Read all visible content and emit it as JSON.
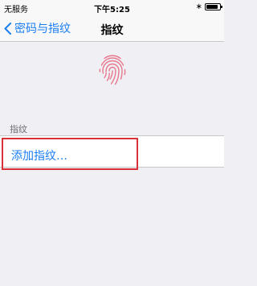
{
  "status_bar": {
    "carrier": "无服务",
    "time": "下午5:25",
    "bluetooth_icon": "bluetooth-icon",
    "battery_icon": "battery-icon",
    "battery_level": 0.85
  },
  "nav": {
    "back_label": "密码与指纹",
    "back_icon": "chevron-left-icon",
    "title": "指纹"
  },
  "fingerprint": {
    "icon": "fingerprint-icon",
    "color": "#e8788e"
  },
  "section": {
    "header": "指纹",
    "add_label": "添加指纹…",
    "highlight_color": "#d9303a"
  },
  "colors": {
    "accent": "#1a7ef2",
    "background": "#efeff4"
  }
}
